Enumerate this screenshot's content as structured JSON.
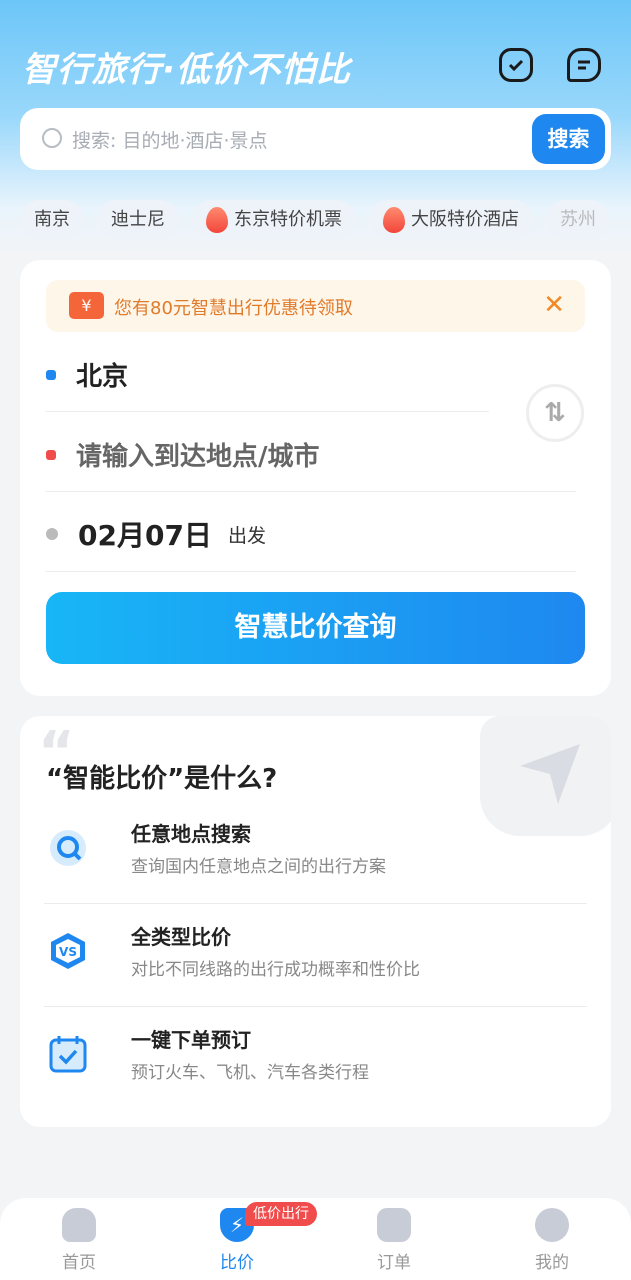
{
  "header": {
    "slogan": "智行旅行·低价不怕比",
    "icons": [
      "alarm-check-icon",
      "message-icon"
    ]
  },
  "search": {
    "placeholder": "搜索: 目的地·酒店·景点",
    "button": "搜索"
  },
  "chips": [
    {
      "label": "南京",
      "hot": false
    },
    {
      "label": "迪士尼",
      "hot": false
    },
    {
      "label": "东京特价机票",
      "hot": true
    },
    {
      "label": "大阪特价酒店",
      "hot": true
    },
    {
      "label": "苏州",
      "hot": false
    }
  ],
  "booking": {
    "promo": "您有80元智慧出行优惠待领取",
    "coupon_symbol": "¥",
    "from": "北京",
    "to_placeholder": "请输入到达地点/城市",
    "date": "02月07日",
    "date_suffix": "出发",
    "submit": "智慧比价查询"
  },
  "intro": {
    "title": "“智能比价”是什么?",
    "features": [
      {
        "title": "任意地点搜索",
        "desc": "查询国内任意地点之间的出行方案",
        "icon": "search-location-icon"
      },
      {
        "title": "全类型比价",
        "desc": "对比不同线路的出行成功概率和性价比",
        "icon": "vs-icon"
      },
      {
        "title": "一键下单预订",
        "desc": "预订火车、飞机、汽车各类行程",
        "icon": "calendar-check-icon"
      }
    ]
  },
  "tabbar": {
    "items": [
      {
        "label": "首页"
      },
      {
        "label": "比价",
        "active": true
      },
      {
        "label": "订单"
      },
      {
        "label": "我的"
      }
    ],
    "badge": "低价出行"
  },
  "colors": {
    "accent": "#1e88f0",
    "promo": "#e07b2a",
    "badge": "#f04c4c"
  }
}
